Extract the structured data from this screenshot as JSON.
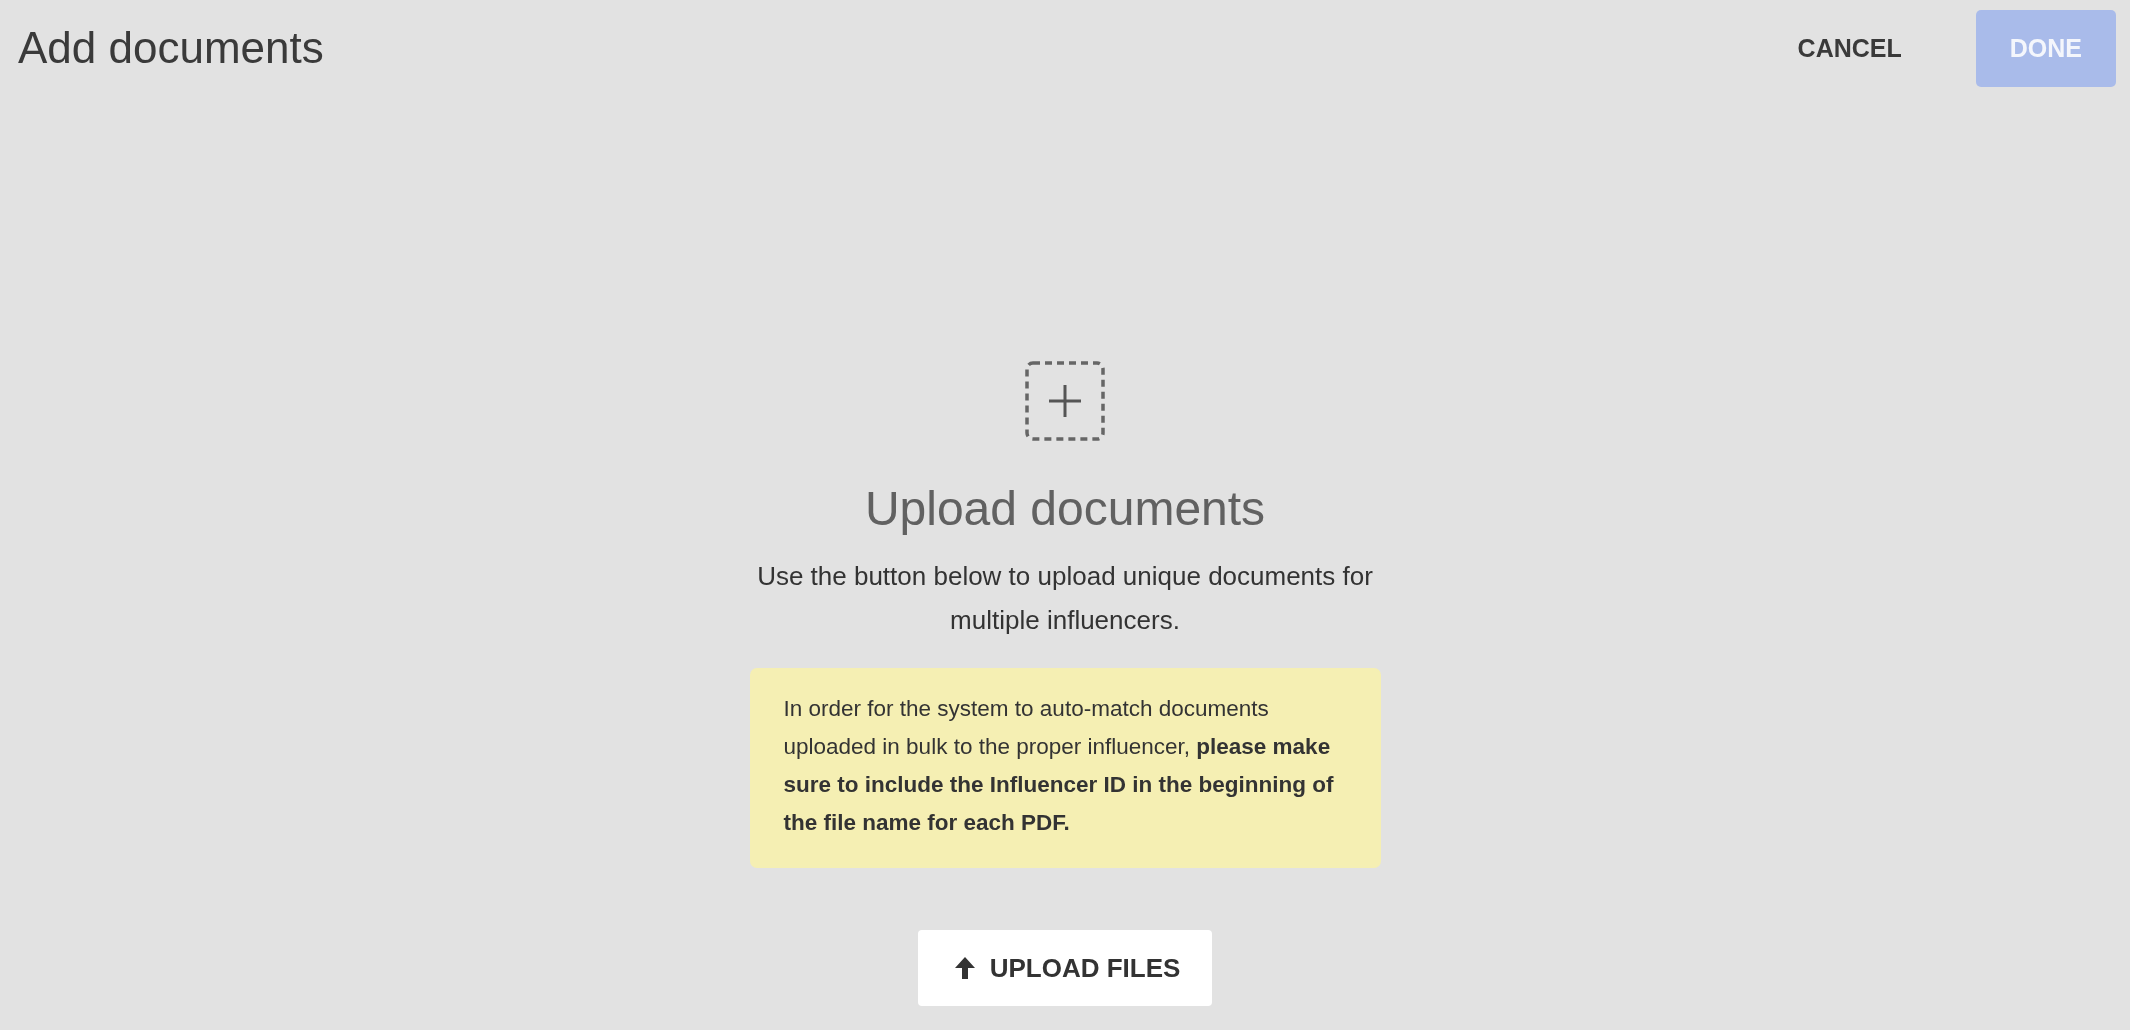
{
  "header": {
    "title": "Add documents",
    "actions": [
      {
        "label": "CANCEL",
        "kind": "text",
        "disabled": false
      },
      {
        "label": "DONE",
        "kind": "primary",
        "disabled": true
      }
    ]
  },
  "upload": {
    "heading": "Upload documents",
    "description": "Use the button below to upload unique documents for multiple influencers.",
    "note": "In order for the system to auto-match documents uploaded in bulk to the proper influencer, **please make sure to include the Influencer ID in the beginning of the file name for each PDF.**",
    "button": "UPLOAD FILES"
  }
}
